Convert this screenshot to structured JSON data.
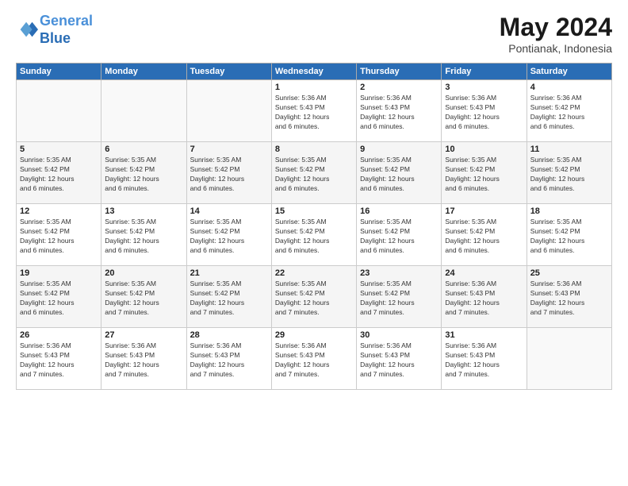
{
  "header": {
    "logo_line1": "General",
    "logo_line2": "Blue",
    "month": "May 2024",
    "location": "Pontianak, Indonesia"
  },
  "weekdays": [
    "Sunday",
    "Monday",
    "Tuesday",
    "Wednesday",
    "Thursday",
    "Friday",
    "Saturday"
  ],
  "weeks": [
    [
      {
        "day": "",
        "info": ""
      },
      {
        "day": "",
        "info": ""
      },
      {
        "day": "",
        "info": ""
      },
      {
        "day": "1",
        "info": "Sunrise: 5:36 AM\nSunset: 5:43 PM\nDaylight: 12 hours\nand 6 minutes."
      },
      {
        "day": "2",
        "info": "Sunrise: 5:36 AM\nSunset: 5:43 PM\nDaylight: 12 hours\nand 6 minutes."
      },
      {
        "day": "3",
        "info": "Sunrise: 5:36 AM\nSunset: 5:43 PM\nDaylight: 12 hours\nand 6 minutes."
      },
      {
        "day": "4",
        "info": "Sunrise: 5:36 AM\nSunset: 5:42 PM\nDaylight: 12 hours\nand 6 minutes."
      }
    ],
    [
      {
        "day": "5",
        "info": "Sunrise: 5:35 AM\nSunset: 5:42 PM\nDaylight: 12 hours\nand 6 minutes."
      },
      {
        "day": "6",
        "info": "Sunrise: 5:35 AM\nSunset: 5:42 PM\nDaylight: 12 hours\nand 6 minutes."
      },
      {
        "day": "7",
        "info": "Sunrise: 5:35 AM\nSunset: 5:42 PM\nDaylight: 12 hours\nand 6 minutes."
      },
      {
        "day": "8",
        "info": "Sunrise: 5:35 AM\nSunset: 5:42 PM\nDaylight: 12 hours\nand 6 minutes."
      },
      {
        "day": "9",
        "info": "Sunrise: 5:35 AM\nSunset: 5:42 PM\nDaylight: 12 hours\nand 6 minutes."
      },
      {
        "day": "10",
        "info": "Sunrise: 5:35 AM\nSunset: 5:42 PM\nDaylight: 12 hours\nand 6 minutes."
      },
      {
        "day": "11",
        "info": "Sunrise: 5:35 AM\nSunset: 5:42 PM\nDaylight: 12 hours\nand 6 minutes."
      }
    ],
    [
      {
        "day": "12",
        "info": "Sunrise: 5:35 AM\nSunset: 5:42 PM\nDaylight: 12 hours\nand 6 minutes."
      },
      {
        "day": "13",
        "info": "Sunrise: 5:35 AM\nSunset: 5:42 PM\nDaylight: 12 hours\nand 6 minutes."
      },
      {
        "day": "14",
        "info": "Sunrise: 5:35 AM\nSunset: 5:42 PM\nDaylight: 12 hours\nand 6 minutes."
      },
      {
        "day": "15",
        "info": "Sunrise: 5:35 AM\nSunset: 5:42 PM\nDaylight: 12 hours\nand 6 minutes."
      },
      {
        "day": "16",
        "info": "Sunrise: 5:35 AM\nSunset: 5:42 PM\nDaylight: 12 hours\nand 6 minutes."
      },
      {
        "day": "17",
        "info": "Sunrise: 5:35 AM\nSunset: 5:42 PM\nDaylight: 12 hours\nand 6 minutes."
      },
      {
        "day": "18",
        "info": "Sunrise: 5:35 AM\nSunset: 5:42 PM\nDaylight: 12 hours\nand 6 minutes."
      }
    ],
    [
      {
        "day": "19",
        "info": "Sunrise: 5:35 AM\nSunset: 5:42 PM\nDaylight: 12 hours\nand 6 minutes."
      },
      {
        "day": "20",
        "info": "Sunrise: 5:35 AM\nSunset: 5:42 PM\nDaylight: 12 hours\nand 7 minutes."
      },
      {
        "day": "21",
        "info": "Sunrise: 5:35 AM\nSunset: 5:42 PM\nDaylight: 12 hours\nand 7 minutes."
      },
      {
        "day": "22",
        "info": "Sunrise: 5:35 AM\nSunset: 5:42 PM\nDaylight: 12 hours\nand 7 minutes."
      },
      {
        "day": "23",
        "info": "Sunrise: 5:35 AM\nSunset: 5:42 PM\nDaylight: 12 hours\nand 7 minutes."
      },
      {
        "day": "24",
        "info": "Sunrise: 5:36 AM\nSunset: 5:43 PM\nDaylight: 12 hours\nand 7 minutes."
      },
      {
        "day": "25",
        "info": "Sunrise: 5:36 AM\nSunset: 5:43 PM\nDaylight: 12 hours\nand 7 minutes."
      }
    ],
    [
      {
        "day": "26",
        "info": "Sunrise: 5:36 AM\nSunset: 5:43 PM\nDaylight: 12 hours\nand 7 minutes."
      },
      {
        "day": "27",
        "info": "Sunrise: 5:36 AM\nSunset: 5:43 PM\nDaylight: 12 hours\nand 7 minutes."
      },
      {
        "day": "28",
        "info": "Sunrise: 5:36 AM\nSunset: 5:43 PM\nDaylight: 12 hours\nand 7 minutes."
      },
      {
        "day": "29",
        "info": "Sunrise: 5:36 AM\nSunset: 5:43 PM\nDaylight: 12 hours\nand 7 minutes."
      },
      {
        "day": "30",
        "info": "Sunrise: 5:36 AM\nSunset: 5:43 PM\nDaylight: 12 hours\nand 7 minutes."
      },
      {
        "day": "31",
        "info": "Sunrise: 5:36 AM\nSunset: 5:43 PM\nDaylight: 12 hours\nand 7 minutes."
      },
      {
        "day": "",
        "info": ""
      }
    ]
  ]
}
